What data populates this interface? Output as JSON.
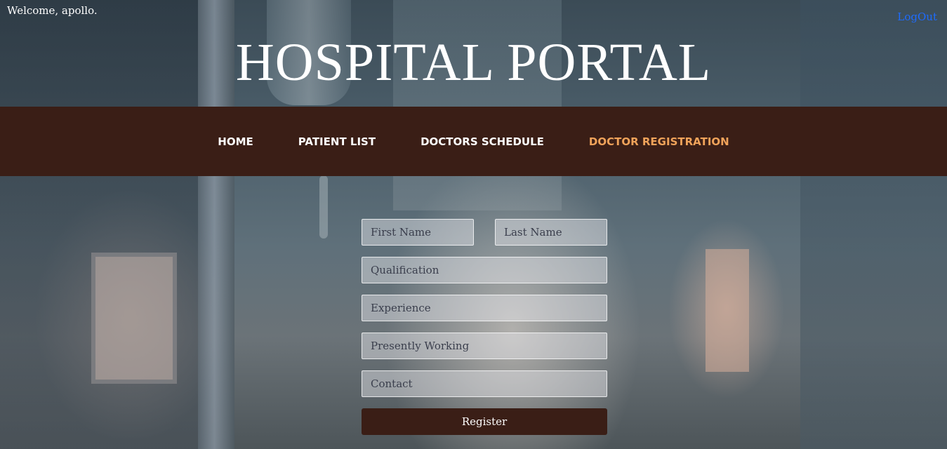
{
  "header": {
    "welcome_text": "Welcome, apollo.",
    "logout_label": "LogOut",
    "title": "HOSPITAL PORTAL"
  },
  "nav": {
    "items": [
      {
        "label": "HOME"
      },
      {
        "label": "PATIENT LIST"
      },
      {
        "label": "DOCTORS SCHEDULE"
      },
      {
        "label": "DOCTOR REGISTRATION",
        "active": true
      }
    ]
  },
  "form": {
    "first_name_placeholder": "First Name",
    "last_name_placeholder": "Last Name",
    "qualification_placeholder": "Qualification",
    "experience_placeholder": "Experience",
    "presently_working_placeholder": "Presently Working",
    "contact_placeholder": "Contact",
    "first_name_value": "",
    "last_name_value": "",
    "qualification_value": "",
    "experience_value": "",
    "presently_working_value": "",
    "contact_value": "",
    "register_label": "Register"
  },
  "colors": {
    "nav_background": "#3a1e16",
    "active_nav": "#f0a35a",
    "logout_link": "#1e6cff",
    "button_background": "#3a1e16"
  }
}
